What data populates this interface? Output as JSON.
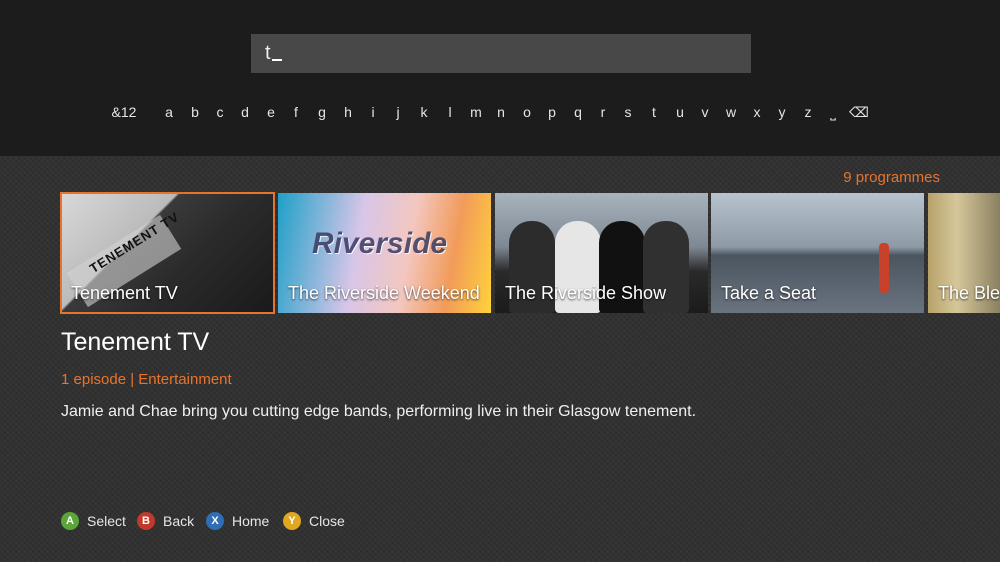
{
  "search": {
    "value": "t"
  },
  "keyboard": {
    "keys": [
      "&12",
      "a",
      "b",
      "c",
      "d",
      "e",
      "f",
      "g",
      "h",
      "i",
      "j",
      "k",
      "l",
      "m",
      "n",
      "o",
      "p",
      "q",
      "r",
      "s",
      "t",
      "u",
      "v",
      "w",
      "x",
      "y",
      "z",
      "space",
      "backspace"
    ],
    "labels": {
      "symbols": "&12",
      "a": "a",
      "b": "b",
      "c": "c",
      "d": "d",
      "e": "e",
      "f": "f",
      "g": "g",
      "h": "h",
      "i": "i",
      "j": "j",
      "k": "k",
      "l": "l",
      "m": "m",
      "n": "n",
      "o": "o",
      "p": "p",
      "q": "q",
      "r": "r",
      "s": "s",
      "t": "t",
      "u": "u",
      "v": "v",
      "w": "w",
      "x": "x",
      "y": "y",
      "z": "z",
      "space": "⎵",
      "backspace": "⌫"
    }
  },
  "results": {
    "count_label": "9 programmes",
    "tiles": [
      {
        "label": "Tenement TV",
        "art_text": "TENEMENT TV",
        "selected": true
      },
      {
        "label": "The Riverside Weekend",
        "art_text": "Riverside",
        "selected": false
      },
      {
        "label": "The Riverside Show",
        "selected": false
      },
      {
        "label": "Take a Seat",
        "selected": false
      },
      {
        "label": "The Ble",
        "selected": false
      }
    ]
  },
  "details": {
    "title": "Tenement TV",
    "meta": "1 episode | Entertainment",
    "description": "Jamie and Chae bring you cutting edge bands, performing live in their Glasgow tenement."
  },
  "controller_hints": [
    {
      "button": "A",
      "label": "Select",
      "color": "#5ca53b"
    },
    {
      "button": "B",
      "label": "Back",
      "color": "#c0392b"
    },
    {
      "button": "X",
      "label": "Home",
      "color": "#2f6db5"
    },
    {
      "button": "Y",
      "label": "Close",
      "color": "#e0a820"
    }
  ],
  "colors": {
    "accent": "#e8742c",
    "top_bar": "#1c1c1c",
    "search_box": "#484848"
  }
}
